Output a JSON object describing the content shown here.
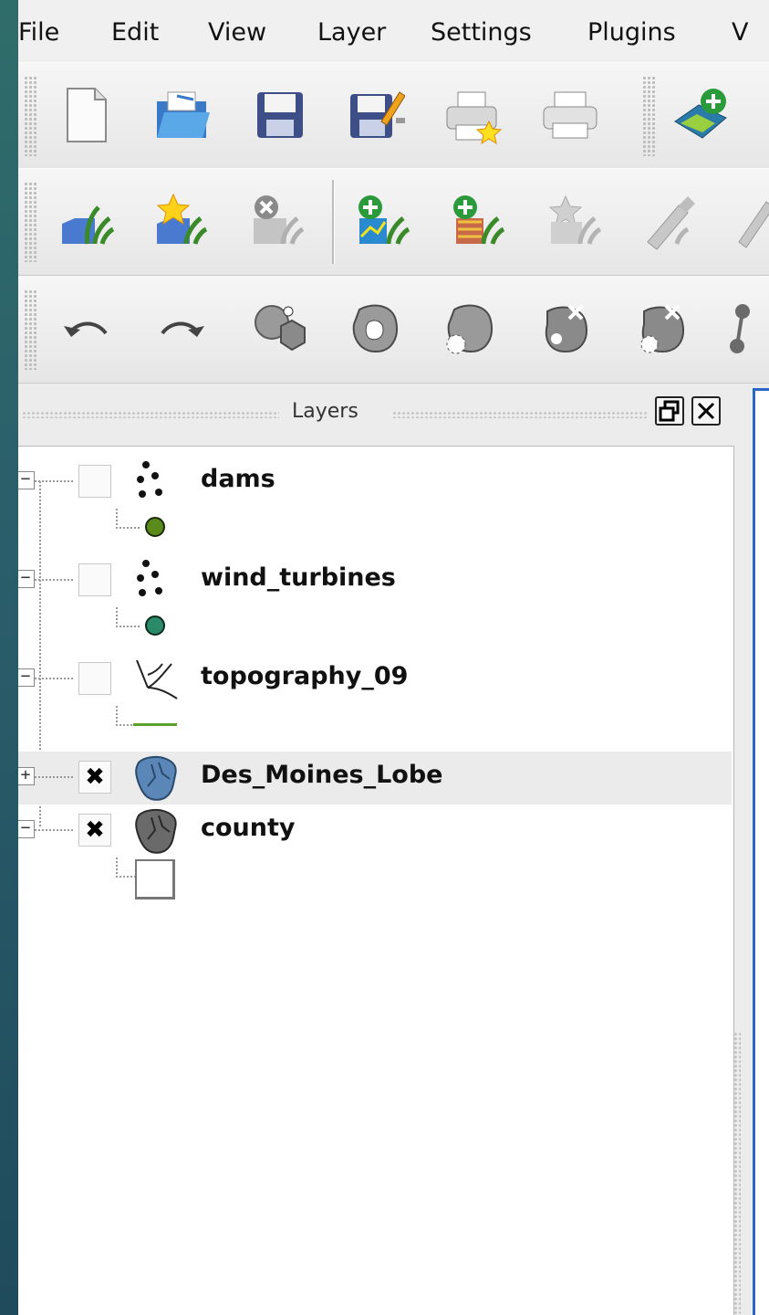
{
  "menubar": {
    "items": [
      "File",
      "Edit",
      "View",
      "Layer",
      "Settings",
      "Plugins",
      "V"
    ]
  },
  "toolbars": {
    "file": [
      "new-project-icon",
      "open-project-icon",
      "save-project-icon",
      "save-as-icon",
      "new-print-composer-icon",
      "print-composer-icon",
      "add-vector-layer-icon"
    ],
    "layer": [
      "add-layer-icon",
      "add-favorite-layer-icon",
      "remove-layer-icon",
      "add-raster-layer-icon",
      "add-postgis-layer-icon",
      "add-wms-layer-icon",
      "toggle-editing-icon",
      "digitize-icon"
    ],
    "edit": [
      "undo-icon",
      "redo-icon",
      "add-part-icon",
      "add-ring-icon",
      "simplify-feature-icon",
      "delete-part-icon",
      "delete-ring-icon",
      "node-tool-icon"
    ]
  },
  "layers_panel": {
    "title": "Layers",
    "layers": [
      {
        "name": "dams",
        "checked": false,
        "expanded": true,
        "type": "point",
        "symbol_color": "#5a8a1a"
      },
      {
        "name": "wind_turbines",
        "checked": false,
        "expanded": true,
        "type": "point",
        "symbol_color": "#2a8a6a"
      },
      {
        "name": "topography_09",
        "checked": false,
        "expanded": true,
        "type": "line",
        "symbol_color": "#5aa02a"
      },
      {
        "name": "Des_Moines_Lobe",
        "checked": true,
        "expanded": false,
        "type": "polygon",
        "symbol_color": "#5b86b8"
      },
      {
        "name": "county",
        "checked": true,
        "expanded": true,
        "type": "polygon",
        "symbol_color": "#666666"
      }
    ],
    "check_mark": "✖"
  }
}
